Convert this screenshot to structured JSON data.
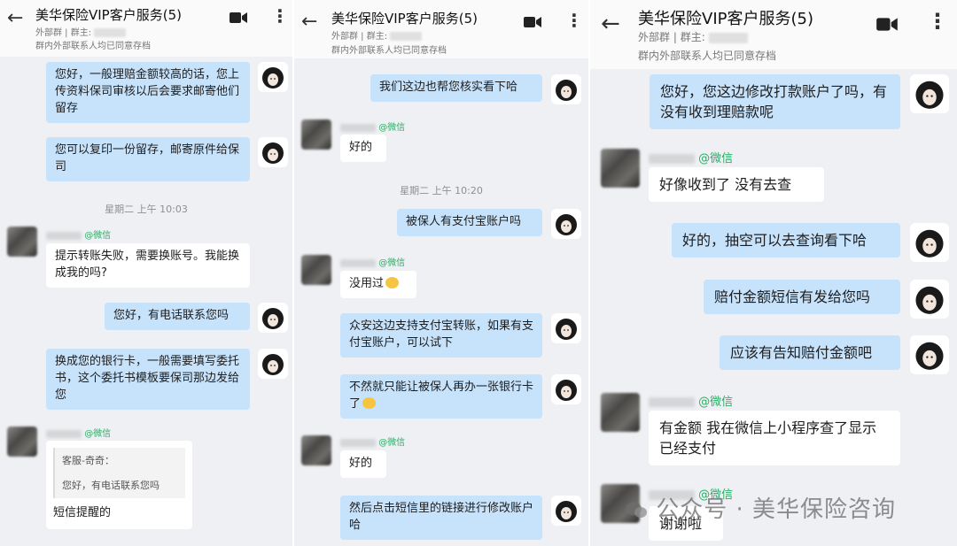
{
  "watermark": "公众号 · 美华保险咨询",
  "panels": [
    {
      "title": "美华保险VIP客户服务(5)",
      "sub_tag": "外部群",
      "sub_owner": "群主:",
      "sub_note": "群内外部联系人均已同意存档",
      "messages": [
        {
          "text": "您好，一般理赔金额较高的话，您上传资料保司审核以后会要求邮寄他们留存"
        },
        {
          "text": "您可以复印一份留存，邮寄原件给保司"
        },
        {
          "time": "星期二 上午 10:03"
        },
        {
          "source": "@微信",
          "text": "提示转账失败，需要换账号。我能换成我的吗?"
        },
        {
          "text": "您好，有电话联系您吗"
        },
        {
          "text": "换成您的银行卡，一般需要填写委托书，这个委托书模板要保司那边发给您"
        },
        {
          "source": "@微信",
          "quote_name": "客服-奇奇：",
          "quote_text": "您好，有电话联系您吗",
          "text": "短信提醒的"
        }
      ]
    },
    {
      "title": "美华保险VIP客户服务(5)",
      "sub_tag": "外部群",
      "sub_owner": "群主:",
      "sub_note": "群内外部联系人均已同意存档",
      "messages": [
        {
          "text": "我们这边也帮您核实看下哈"
        },
        {
          "source": "@微信",
          "text": "好的"
        },
        {
          "time": "星期二 上午 10:20"
        },
        {
          "text": "被保人有支付宝账户吗"
        },
        {
          "source": "@微信",
          "text": "没用过"
        },
        {
          "text": "众安这边支持支付宝转账，如果有支付宝账户，可以试下"
        },
        {
          "text": "不然就只能让被保人再办一张银行卡了"
        },
        {
          "source": "@微信",
          "text": "好的"
        },
        {
          "text": "然后点击短信里的链接进行修改账户哈"
        }
      ]
    },
    {
      "title": "美华保险VIP客户服务(5)",
      "sub_tag": "外部群",
      "sub_owner": "群主:",
      "sub_note": "群内外部联系人均已同意存档",
      "messages": [
        {
          "text": "您好，您这边修改打款账户了吗，有没有收到理赔款呢"
        },
        {
          "source": "@微信",
          "text": "好像收到了 没有去查"
        },
        {
          "text": "好的，抽空可以去查询看下哈"
        },
        {
          "text": "赔付金额短信有发给您吗"
        },
        {
          "text": "应该有告知赔付金额吧"
        },
        {
          "source": "@微信",
          "text": "有金额 我在微信上小程序查了显示已经支付"
        },
        {
          "source": "@微信",
          "text": "谢谢啦"
        }
      ]
    }
  ]
}
